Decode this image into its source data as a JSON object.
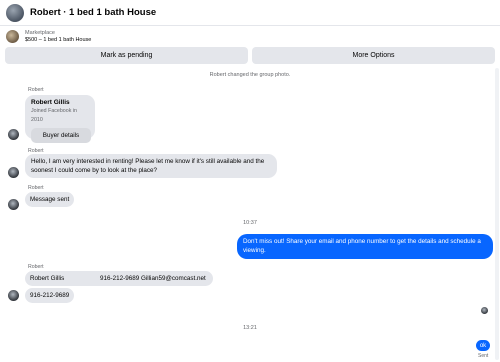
{
  "header": {
    "title": "Robert · 1 bed 1 bath House"
  },
  "listing": {
    "source": "Marketplace",
    "summary": "$500 – 1 bed 1 bath House"
  },
  "actions": {
    "mark_pending": "Mark as pending",
    "more_options": "More Options"
  },
  "conversation": {
    "system_notice": "Robert changed the group photo.",
    "card": {
      "sender": "Robert",
      "name": "Robert Gillis",
      "joined": "Joined Facebook in 2010",
      "button": "Buyer details"
    },
    "msg1": {
      "sender": "Robert",
      "text": "Hello, I am very interested in renting! Please let me know if it's still available and the soonest I could come by to look at the place?"
    },
    "msg2": {
      "sender": "Robert",
      "text": "Message sent"
    },
    "time1": "10:37",
    "reply1": {
      "text": "Don't miss out! Share your email and phone number to get the details and schedule a viewing."
    },
    "msg3": {
      "sender": "Robert",
      "name": "Robert Gillis",
      "contact": "916-212-9689 Gillian59@comcast.net",
      "phone": "916-212-9689"
    },
    "time2": "13:21",
    "reply2": {
      "text": "ok",
      "status": "Sent"
    }
  }
}
